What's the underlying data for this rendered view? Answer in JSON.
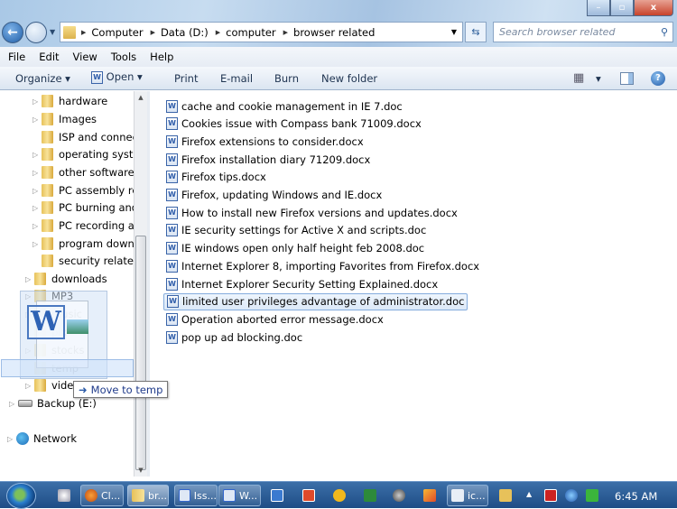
{
  "window": {
    "controls": {
      "minimize": "–",
      "maximize": "▫",
      "close": "x"
    }
  },
  "nav": {
    "back": "←"
  },
  "address": {
    "crumbs": [
      "Computer",
      "Data (D:)",
      "computer",
      "browser related"
    ]
  },
  "search": {
    "placeholder": "Search browser related",
    "icon": "⚲"
  },
  "menu": [
    "File",
    "Edit",
    "View",
    "Tools",
    "Help"
  ],
  "toolbar": {
    "organize": "Organize ▾",
    "open": "Open",
    "open_arrow": "▾",
    "print": "Print",
    "email": "E-mail",
    "burn": "Burn",
    "new_folder": "New folder",
    "views_arrow": "▾",
    "help": "?"
  },
  "tree": [
    {
      "label": "hardware",
      "expand": true
    },
    {
      "label": "Images",
      "expand": true
    },
    {
      "label": "ISP and connecti",
      "expand": false
    },
    {
      "label": "operating system",
      "expand": true
    },
    {
      "label": "other software",
      "expand": true
    },
    {
      "label": "PC assembly rela",
      "expand": true
    },
    {
      "label": "PC burning and",
      "expand": true
    },
    {
      "label": "PC recording and",
      "expand": true
    },
    {
      "label": "program downlo",
      "expand": true
    },
    {
      "label": "security related",
      "expand": false
    },
    {
      "label": "downloads",
      "expand": true
    },
    {
      "label": "MP3",
      "expand": true
    },
    {
      "label": "music",
      "expand": true
    },
    {
      "label": "pix",
      "expand": false
    },
    {
      "label": "stocks",
      "expand": true
    },
    {
      "label": "temp",
      "expand": false
    },
    {
      "label": "video",
      "expand": true
    },
    {
      "label": "Backup (E:)",
      "expand": true
    },
    {
      "label": "Network",
      "expand": true
    }
  ],
  "files": [
    "cache and cookie management in IE 7.doc",
    "Cookies issue with Compass bank 71009.docx",
    "Firefox extensions to consider.docx",
    "Firefox installation diary 71209.docx",
    "Firefox tips.docx",
    "Firefox, updating Windows and IE.docx",
    "How to install new Firefox versions and updates.docx",
    "IE security settings for Active X and scripts.doc",
    "IE windows open only half height feb 2008.doc",
    "Internet Explorer 8, importing Favorites from Firefox.docx",
    "Internet Explorer Security Setting Explained.docx",
    "limited user privileges advantage of administrator.doc",
    "Operation aborted error message.docx",
    "pop up ad blocking.doc"
  ],
  "selected_file_index": 11,
  "drag": {
    "tooltip": "Move to temp",
    "arrow": "➜",
    "glyph": "W"
  },
  "taskbar": {
    "items": [
      "Cl...",
      "br...",
      "Iss...",
      "W...",
      "ic..."
    ],
    "clock": "6:45 AM",
    "tray_arrow": "▲"
  }
}
